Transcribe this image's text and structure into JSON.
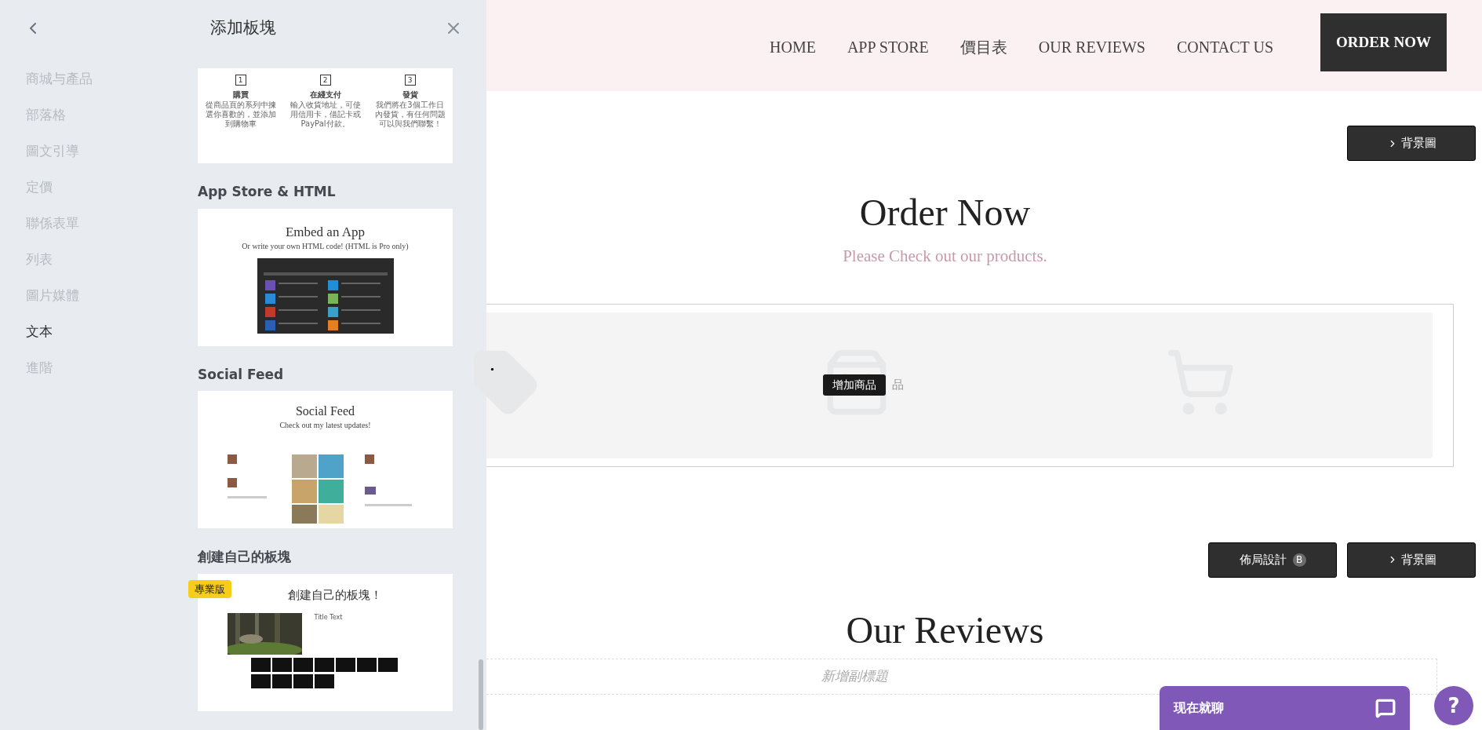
{
  "panel": {
    "title": "添加板塊",
    "categories": [
      {
        "label": "商城与產品",
        "selected": false
      },
      {
        "label": "部落格",
        "selected": false
      },
      {
        "label": "圖文引導",
        "selected": false
      },
      {
        "label": "定價",
        "selected": false
      },
      {
        "label": "聯係表單",
        "selected": false
      },
      {
        "label": "列表",
        "selected": false
      },
      {
        "label": "圖片媒體",
        "selected": false
      },
      {
        "label": "文本",
        "selected": true
      },
      {
        "label": "進階",
        "selected": false
      }
    ],
    "sections": [
      {
        "kind": "steps",
        "steps": [
          {
            "number": "1",
            "title": "購買",
            "text": "從商品頁的系列中揀選你喜歡的，並添加到購物車"
          },
          {
            "number": "2",
            "title": "在綫支付",
            "text": "輸入收貨地址，可使用信用卡，借記卡或PayPal付款。"
          },
          {
            "number": "3",
            "title": "發貨",
            "text": "我們將在3個工作日內發貨，有任何問題可以與我們聯繫！"
          }
        ]
      },
      {
        "kind": "app",
        "heading": "App Store & HTML",
        "title": "Embed an App",
        "subtitle": "Or write your own HTML code! (HTML is Pro only)"
      },
      {
        "kind": "social",
        "heading": "Social Feed",
        "title": "Social Feed",
        "subtitle": "Check out my latest updates!"
      },
      {
        "kind": "custom",
        "heading": "創建自己的板塊",
        "badge": "專業版",
        "title": "創建自己的板塊！",
        "card_title": "Title Text"
      }
    ]
  },
  "site": {
    "nav": [
      "HOME",
      "APP STORE",
      "價目表",
      "OUR REVIEWS",
      "CONTACT US"
    ],
    "cta": "ORDER NOW",
    "order_section": {
      "background_button": "背景圖",
      "title": "Order Now",
      "subtitle": "Please Check out our products.",
      "placeholder_right": "品",
      "tooltip": "增加商品"
    },
    "reviews_section": {
      "layout_button": "佈局設計",
      "layout_badge": "B",
      "background_button": "背景圖",
      "title": "Our Reviews",
      "subtitle_placeholder": "新增副標題"
    },
    "chat": {
      "label": "现在就聊"
    },
    "help": "?"
  }
}
